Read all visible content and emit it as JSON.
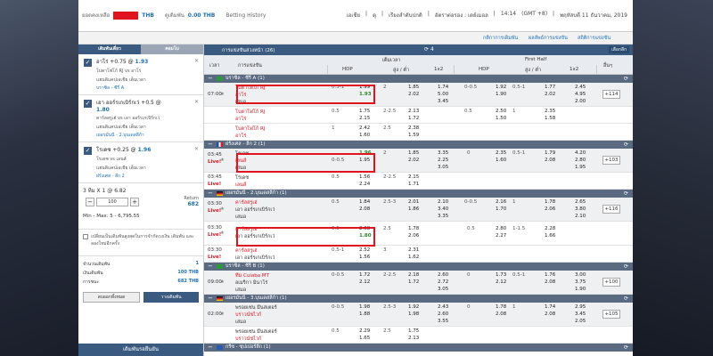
{
  "topbar": {
    "balance_label": "ยอดคงเหลือ",
    "currency": "THB",
    "outstanding_label": "ดูเดิมพัน",
    "outstanding_value": "0.00 THB",
    "history": "Betting History",
    "lang": "เอเชีย",
    "odds_type": "ดุ",
    "settings": "เรียงลำดับปกติ",
    "display": "อัตราต่อรอง : เดย์เมอล",
    "time": "14:14",
    "tz": "(GMT +8)",
    "date": "พฤหัสบดี 11 ธันวาคม, 2019"
  },
  "menu": {
    "a": "กติกาการเดิมพัน",
    "b": "ผลลัพธ์การแข่งขัน",
    "c": "สถิติการแข่งขัน"
  },
  "left": {
    "tab_slip": "เดิมพันเดี่ยว",
    "tab_parlay": "คอมโบ",
    "slips": [
      {
        "pick": "อาโร่ +0.75 @",
        "odd": "1.93",
        "teams": "โบตาโฟโก้ RJ vs อาโร่",
        "type": "แฮนดิแคปเอเชีย เต็มเวลา",
        "league": "บราซิล - ซีรี่ A"
      },
      {
        "pick": "เอา ออร์รเกเบิร์กเว่ +0.5 @",
        "odd": "1.80",
        "teams": "คาร์ลสรูเฮ่ vs เอา ออร์รเกเบิร์กเว่",
        "type": "แฮนดิแคปเอเชีย เต็มเวลา",
        "league": "เยอรมันนี - 2.บุนเดสลีก้า"
      },
      {
        "pick": "โรเดซ +0.25 @",
        "odd": "1.96",
        "teams": "โรเดซ vs เลนส์",
        "type": "แฮนดิแคปเอเชีย เต็มเวลา",
        "league": "ฝรั่งเศส - ลีก 2"
      }
    ],
    "combo_label": "3 ทีม X 1 @ 6.82",
    "stake": "100",
    "return_label": "Return",
    "return_value": "682",
    "minmax": "Min - Max: 5 - 6,795.55",
    "accept_text": "เปลี่ยนเป็นเดิมพันสูงสุดในการจำกัดวงเงิน เดิมพัน และลองใหม่อีกครั้ง",
    "sum": [
      {
        "k": "จำนวนเดิมพัน",
        "v": "1"
      },
      {
        "k": "เงินเดิมพัน",
        "v": "100 THB"
      },
      {
        "k": "การชนะ",
        "v": "682 THB"
      }
    ],
    "clear": "ลบออกทั้งหมด",
    "place": "วางเดิมพัน",
    "waiting": "เดิมพันรอยืนยัน"
  },
  "main": {
    "title": "การแข่งขันล่วงหน้า (26)",
    "count": "4",
    "odds_btn": "เลือกลีก",
    "cols": {
      "time": "เวลา",
      "event": "การแข่งขัน",
      "ft": "เต็มเวลา",
      "fh": "First Half",
      "hdp": "HDP",
      "ou": "สูง / ต่ำ",
      "x12": "1x2",
      "more": "อื่นๆ"
    },
    "leagues": [
      "บราซิล - ซีรี่ A (1)",
      "ฝรั่งเศส - ลีก 2 (1)",
      "เยอรมันนี - 2.บุนเดสลีก้า (1)",
      "บราซิล - ซีรี่ B (1)",
      "เยอรมันนี - 3.บุนเดสลีก้า (1)",
      "กรีซ - ซุปเปอร์ลีก (1)"
    ],
    "m1": {
      "time": "07:00",
      "home": "โบตาโฟโก้ RJ",
      "away": "อาโร่",
      "draw": "เสมอ",
      "hdp": "0.5-1",
      "h1": "1.99",
      "h2": "1.93",
      "ou": "2",
      "o1": "1.85",
      "o2": "2.02",
      "x1": "1.74",
      "x2": "5.00",
      "x3": "3.45",
      "fhdp": "0-0.5",
      "f1": "1.92",
      "f2": "1.90",
      "fou": "0.5-1",
      "fo1": "1.77",
      "fo2": "2.02",
      "fx1": "2.45",
      "fx2": "4.95",
      "fx3": "2.00",
      "more": "+114"
    },
    "m1b": {
      "home": "โบตาโฟโก้ RJ",
      "away": "อาโร่",
      "hdp": "0.5",
      "h1": "1.75",
      "h2": "2.15",
      "ou": "2-2.5",
      "o1": "2.13",
      "o2": "1.72",
      "fhdp": "0.5",
      "f1": "2.50",
      "f2": "1.50",
      "fou": "1",
      "fo1": "2.35",
      "fo2": "1.58"
    },
    "m1c": {
      "home": "โบตาโฟโก้ RJ",
      "away": "อาโร่",
      "hdp": "1",
      "h1": "2.42",
      "h2": "1.60",
      "ou": "2.5",
      "o1": "2.38",
      "o2": "1.59"
    },
    "m2": {
      "time": "03:45",
      "live": "Live!",
      "home": "โรเดซ",
      "away": "เลนส์",
      "draw": "เสมอ",
      "hdp": "0-0.5",
      "h1": "1.96",
      "h2": "1.95",
      "ou": "2",
      "o1": "1.85",
      "o2": "2.02",
      "x1": "3.35",
      "x2": "2.25",
      "x3": "3.05",
      "fhdp": "0",
      "f1": "2.35",
      "f2": "1.60",
      "fou": "0.5-1",
      "fo1": "1.79",
      "fo2": "2.08",
      "fx1": "4.20",
      "fx2": "2.80",
      "fx3": "1.95",
      "more": "+103"
    },
    "m2b": {
      "time": "03:45",
      "live": "Live!",
      "home": "โรเดซ",
      "away": "เลนส์",
      "hdp": "0.5",
      "h1": "1.56",
      "h2": "2.24",
      "ou": "2-2.5",
      "o1": "2.15",
      "o2": "1.71"
    },
    "m3": {
      "time": "03:30",
      "live": "Live!",
      "home": "คาร์ลสรูเฮ่",
      "away": "เอา ออร์รเกเบิร์กเว่",
      "draw": "เสมอ",
      "hdp": "0.5",
      "h1": "1.84",
      "h2": "2.08",
      "ou": "2.5-3",
      "o1": "2.01",
      "o2": "1.86",
      "x1": "2.10",
      "x2": "3.40",
      "x3": "3.35",
      "fhdp": "0-0.5",
      "f1": "2.16",
      "f2": "1.70",
      "fou": "1",
      "fo1": "1.78",
      "fo2": "2.06",
      "fx1": "2.65",
      "fx2": "3.80",
      "fx3": "2.10",
      "more": "+116"
    },
    "m3b": {
      "time": "03:30",
      "live": "Live!",
      "home": "คาร์ลสรูเฮ่",
      "away": "เอา ออร์รเกเบิร์กเว่",
      "hdp": "0.5",
      "h1": "2.08",
      "h2": "1.80",
      "ou": "2.5",
      "o1": "1.78",
      "o2": "2.06",
      "fhdp": "0.5",
      "f1": "2.80",
      "f2": "2.27",
      "fou": "1-1.5",
      "fo1": "2.28",
      "fo2": "1.66"
    },
    "m3c": {
      "time": "03:30",
      "live": "Live!",
      "home": "คาร์ลสรูเฮ่",
      "away": "เอา ออร์รเกเบิร์กเว่",
      "hdp": "0.5-1",
      "h1": "2.52",
      "h2": "1.56",
      "ou": "3",
      "o1": "2.31",
      "o2": "1.62"
    },
    "m4": {
      "time": "09:00",
      "home": "ทีม Cuiaba MT",
      "away": "อเมริกา มินาโร่",
      "draw": "เสมอ",
      "hdp": "0-0.5",
      "h1": "1.72",
      "h2": "2.12",
      "ou": "2-2.5",
      "o1": "2.18",
      "o2": "1.72",
      "x1": "2.60",
      "x2": "2.72",
      "x3": "3.05",
      "fhdp": "0",
      "f1": "1.73",
      "f2": "2.12",
      "fou": "0.5-1",
      "fo1": "1.76",
      "fo2": "2.08",
      "fx1": "3.00",
      "fx2": "3.75",
      "fx3": "1.90",
      "more": "+100"
    },
    "m5": {
      "time": "02:00",
      "home": "พรอยเซ่น มึนสเตอร์",
      "away": "บราวน์ชไวก์",
      "draw": "เสมอ",
      "hdp": "0-0.5",
      "h1": "1.98",
      "h2": "1.88",
      "ou": "2.5-3",
      "o1": "1.92",
      "o2": "1.98",
      "x1": "2.43",
      "x2": "2.60",
      "x3": "3.55",
      "fhdp": "0",
      "f1": "1.78",
      "f2": "2.08",
      "fou": "1",
      "fo1": "1.74",
      "fo2": "2.08",
      "fx1": "2.95",
      "fx2": "3.45",
      "fx3": "2.05",
      "more": "+105"
    },
    "m5b": {
      "home": "พรอยเซ่น มึนสเตอร์",
      "away": "บราวน์ชไวก์",
      "hdp": "0.5",
      "h1": "2.29",
      "h2": "1.65",
      "ou": "2.5",
      "o1": "1.75",
      "o2": "2.13"
    }
  }
}
